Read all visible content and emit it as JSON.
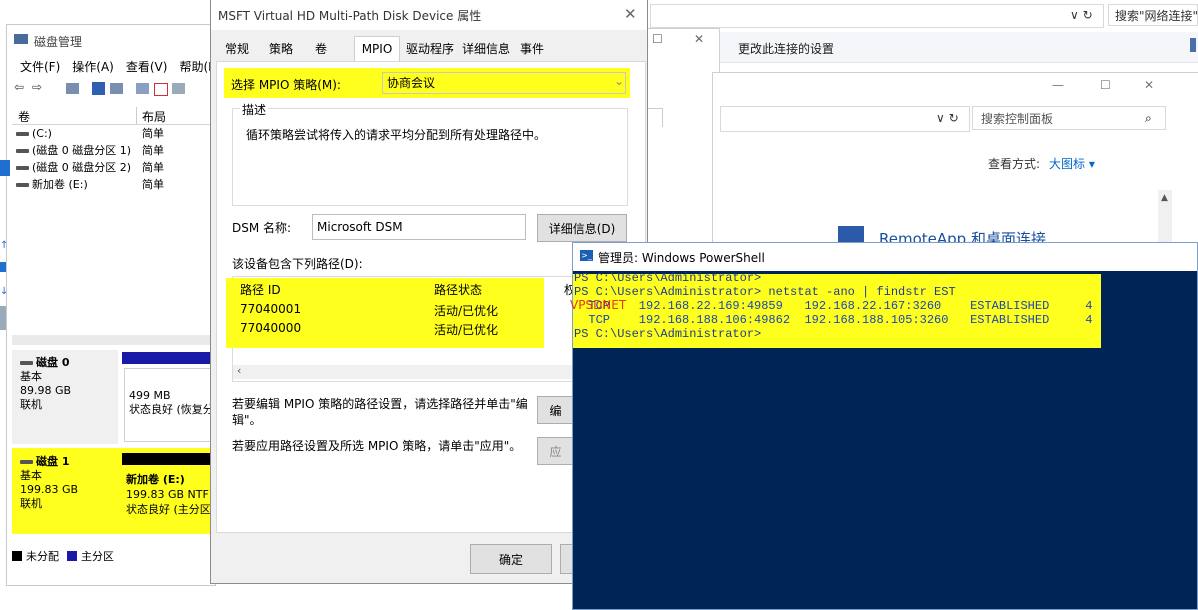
{
  "network_window": {
    "address_controls": "∨ ↻",
    "search_placeholder": "搜索\"网络连接\"",
    "close_glyph": "✕",
    "restore_glyph": "☐",
    "command": "更改此连接的设置"
  },
  "control_panel": {
    "min_glyph": "—",
    "max_glyph": "☐",
    "close_glyph": "✕",
    "address_controls": "∨ ↻",
    "search_placeholder": "搜索控制面板",
    "view_by_label": "查看方式:",
    "view_by_value": "大图标 ▾",
    "item_remoteapp": "RemoteApp 和桌面连接"
  },
  "disk_management": {
    "title": "磁盘管理",
    "menu": [
      "文件(F)",
      "操作(A)",
      "查看(V)",
      "帮助(H)"
    ],
    "columns": {
      "volume": "卷",
      "layout": "布局"
    },
    "volumes": [
      {
        "name": "(C:)",
        "layout": "简单"
      },
      {
        "name": "(磁盘 0 磁盘分区 1)",
        "layout": "简单"
      },
      {
        "name": "(磁盘 0 磁盘分区 2)",
        "layout": "简单"
      },
      {
        "name": "新加卷 (E:)",
        "layout": "简单"
      }
    ],
    "disk0": {
      "name": "磁盘 0",
      "type": "基本",
      "size": "89.98 GB",
      "status": "联机",
      "partition_size": "499 MB",
      "partition_status": "状态良好 (恢复分"
    },
    "disk1": {
      "name": "磁盘 1",
      "type": "基本",
      "size": "199.83 GB",
      "status": "联机",
      "volume_name": "新加卷 (E:)",
      "volume_size": "199.83 GB NTF",
      "volume_status": "状态良好 (主分区"
    },
    "legend": {
      "unallocated": "未分配",
      "primary": "主分区"
    },
    "colors": {
      "unallocated": "#000000",
      "primary": "#1a1aa6"
    }
  },
  "mpio_dialog": {
    "title": "MSFT Virtual HD  Multi-Path Disk Device 属性",
    "close_glyph": "✕",
    "tabs": [
      "常规",
      "策略",
      "卷",
      "MPIO",
      "驱动程序",
      "详细信息",
      "事件"
    ],
    "policy_label": "选择 MPIO 策略(M):",
    "policy_value": "协商会议",
    "dropdown_glyph": "⌄",
    "description_heading": "描述",
    "description_text": "循环策略尝试将传入的请求平均分配到所有处理路径中。",
    "dsm_label": "DSM 名称:",
    "dsm_value": "Microsoft DSM",
    "details_button": "详细信息(D)",
    "paths_label": "该设备包含下列路径(D):",
    "paths_columns": [
      "路径 ID",
      "路径状态",
      "权"
    ],
    "paths": [
      {
        "id": "77040001",
        "state": "活动/已优化"
      },
      {
        "id": "77040000",
        "state": "活动/已优化"
      }
    ],
    "scroll_left": "‹",
    "edit_hint": "若要编辑 MPIO 策略的路径设置，请选择路径并单击\"编辑\"。",
    "edit_button": "编",
    "apply_hint": "若要应用路径设置及所选 MPIO 策略，请单击\"应用\"。",
    "apply_button": "应",
    "ok_button": "确定"
  },
  "powershell": {
    "title": "管理员: Windows PowerShell",
    "lines": [
      "PS C:\\Users\\Administrator>",
      "PS C:\\Users\\Administrator> netstat -ano | findstr EST",
      "  TCP    192.168.22.169:49859   192.168.22.167:3260    ESTABLISHED     4",
      "  TCP    192.168.188.106:49862  192.168.188.105:3260   ESTABLISHED     4",
      "PS C:\\Users\\Administrator>"
    ],
    "watermark": "VPSDNET"
  },
  "highlight_color": "#ffff1e"
}
